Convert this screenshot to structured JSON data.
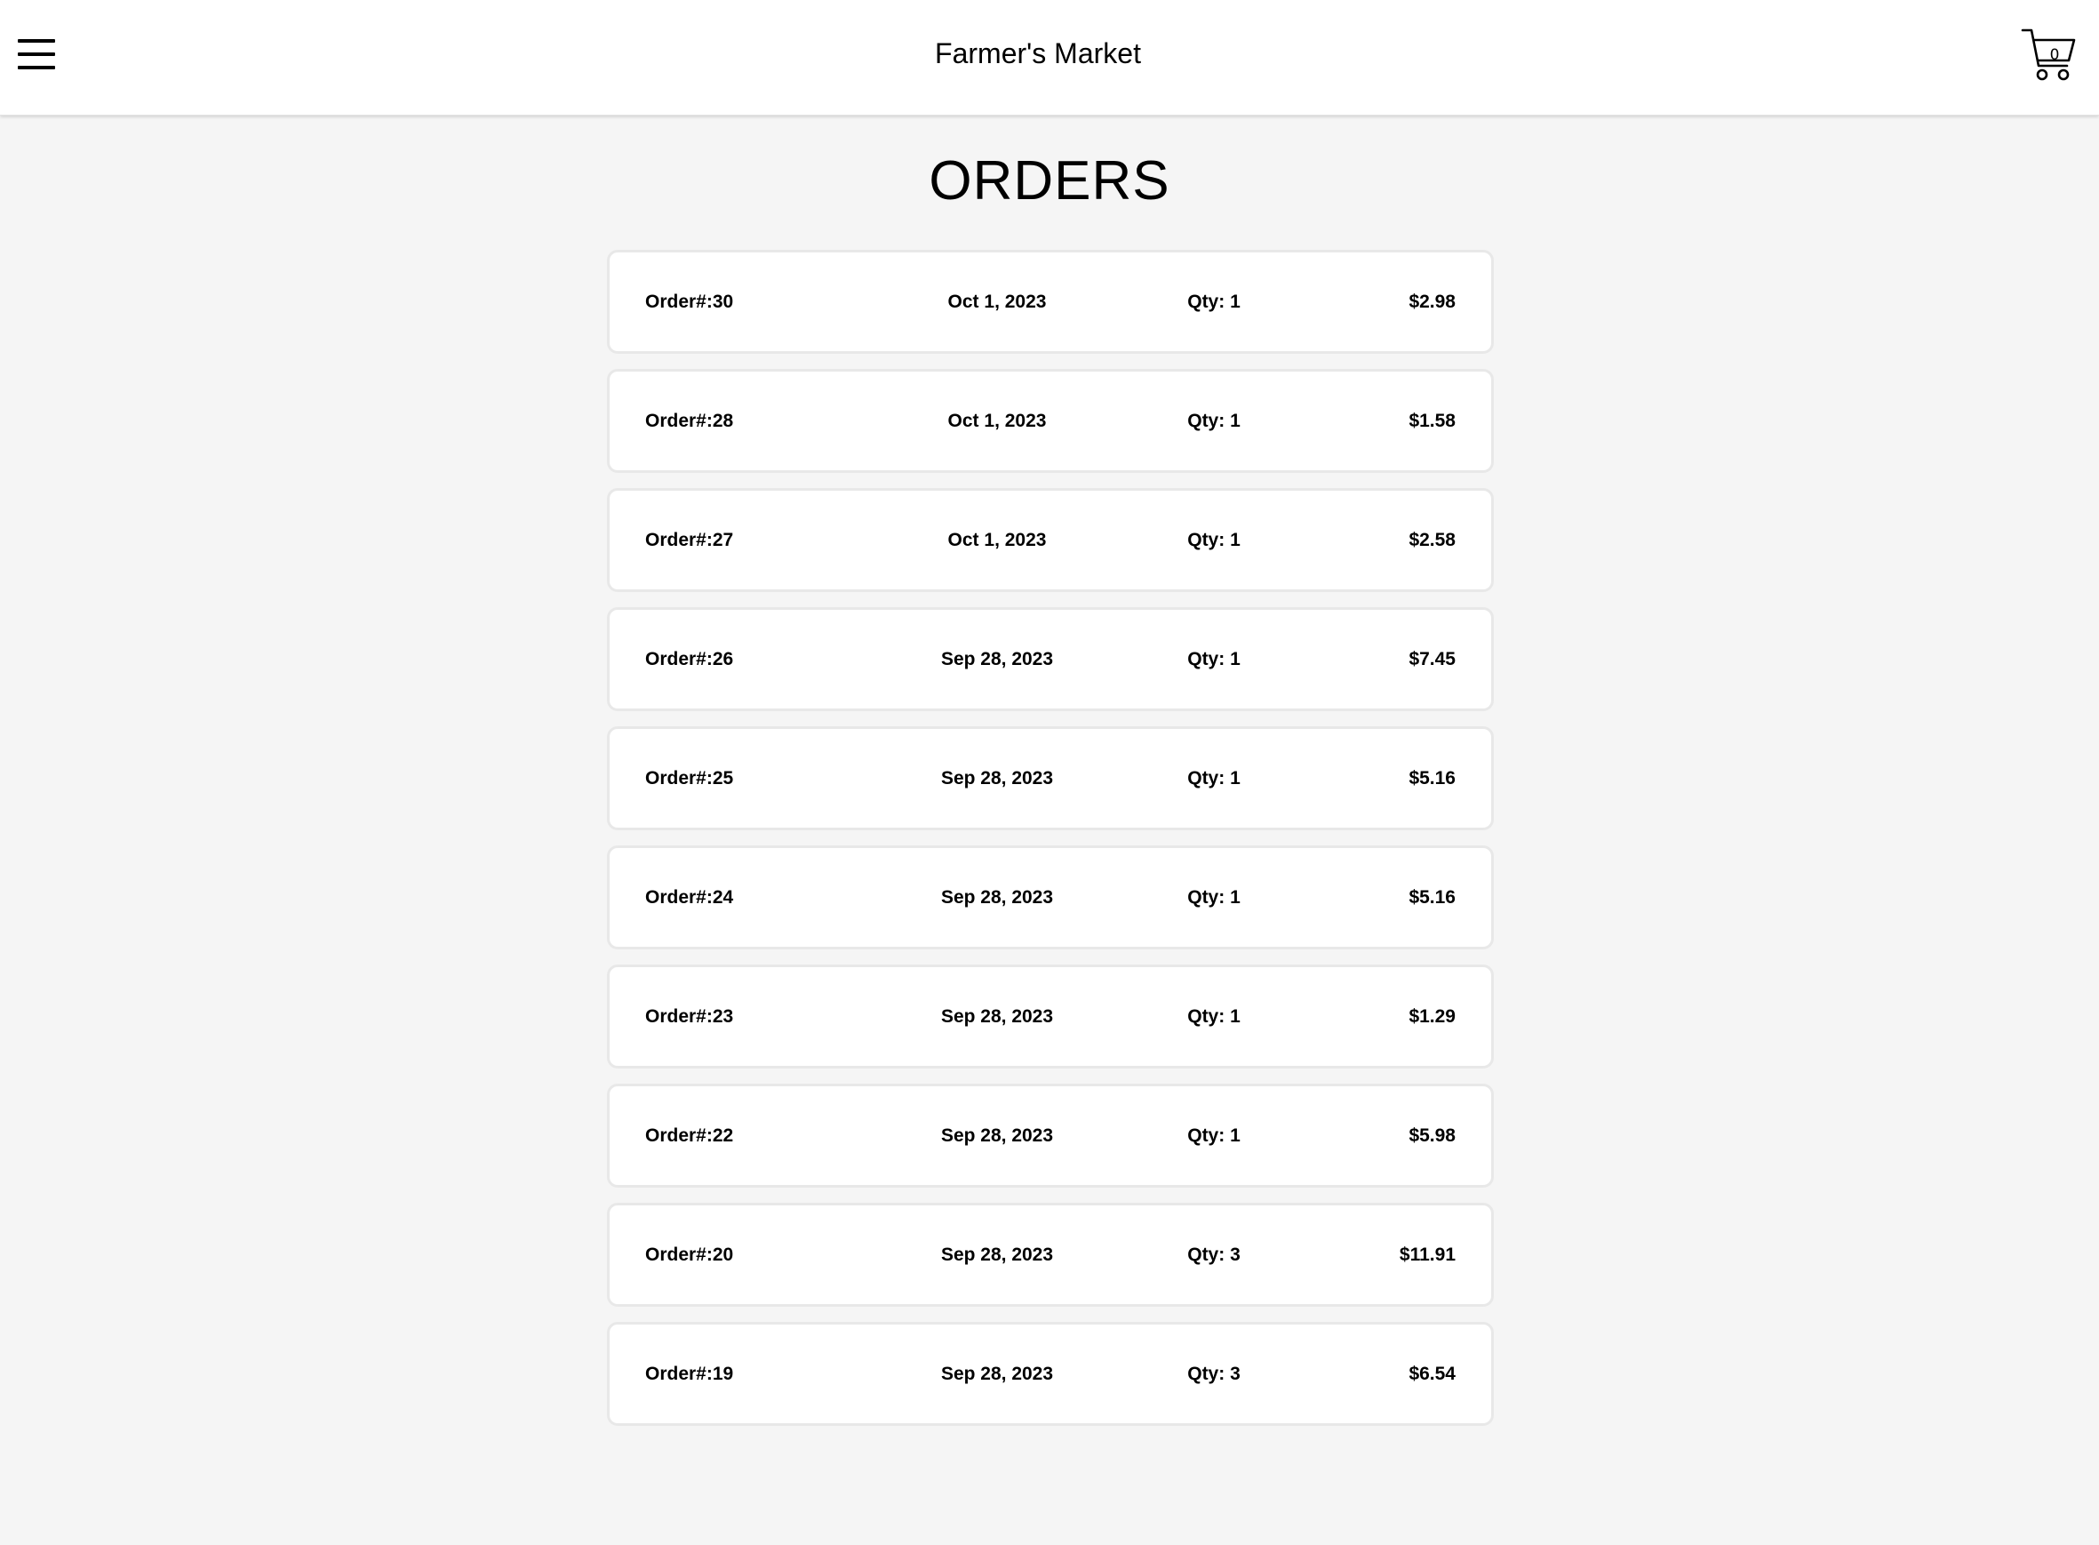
{
  "header": {
    "title": "Farmer's Market",
    "cart_count": "0",
    "menu_icon": "hamburger-menu-icon",
    "cart_icon": "shopping-cart-icon"
  },
  "page": {
    "heading": "ORDERS"
  },
  "orders": [
    {
      "id": "Order#:30",
      "date": "Oct 1, 2023",
      "qty": "Qty: 1",
      "total": "$2.98"
    },
    {
      "id": "Order#:28",
      "date": "Oct 1, 2023",
      "qty": "Qty: 1",
      "total": "$1.58"
    },
    {
      "id": "Order#:27",
      "date": "Oct 1, 2023",
      "qty": "Qty: 1",
      "total": "$2.58"
    },
    {
      "id": "Order#:26",
      "date": "Sep 28, 2023",
      "qty": "Qty: 1",
      "total": "$7.45"
    },
    {
      "id": "Order#:25",
      "date": "Sep 28, 2023",
      "qty": "Qty: 1",
      "total": "$5.16"
    },
    {
      "id": "Order#:24",
      "date": "Sep 28, 2023",
      "qty": "Qty: 1",
      "total": "$5.16"
    },
    {
      "id": "Order#:23",
      "date": "Sep 28, 2023",
      "qty": "Qty: 1",
      "total": "$1.29"
    },
    {
      "id": "Order#:22",
      "date": "Sep 28, 2023",
      "qty": "Qty: 1",
      "total": "$5.98"
    },
    {
      "id": "Order#:20",
      "date": "Sep 28, 2023",
      "qty": "Qty: 3",
      "total": "$11.91"
    },
    {
      "id": "Order#:19",
      "date": "Sep 28, 2023",
      "qty": "Qty: 3",
      "total": "$6.54"
    }
  ],
  "colors": {
    "page_background": "#f5f5f5",
    "card_background": "#ffffff",
    "card_border": "#e8e8e8",
    "text": "#000000"
  }
}
